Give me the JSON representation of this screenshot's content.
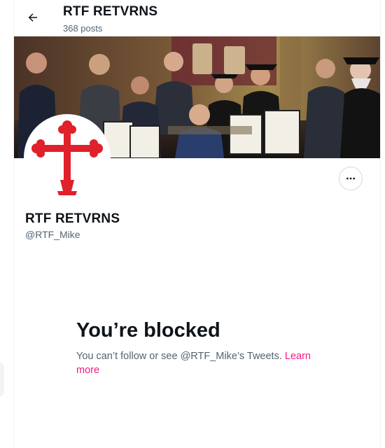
{
  "header": {
    "title": "RTF RETVRNS",
    "post_count": "368 posts"
  },
  "profile": {
    "display_name": "RTF RETVRNS",
    "handle": "@RTF_Mike"
  },
  "blocked": {
    "title": "You’re blocked",
    "body": "You can’t follow or see @RTF_Mike’s Tweets.",
    "link": "Learn more"
  },
  "icons": {
    "back": "arrow-left-icon",
    "more": "more-horizontal-icon",
    "avatar": "red-cross-emblem"
  },
  "colors": {
    "link": "#f91880",
    "secondary_text": "#536471",
    "avatar_cross": "#e0202a"
  }
}
